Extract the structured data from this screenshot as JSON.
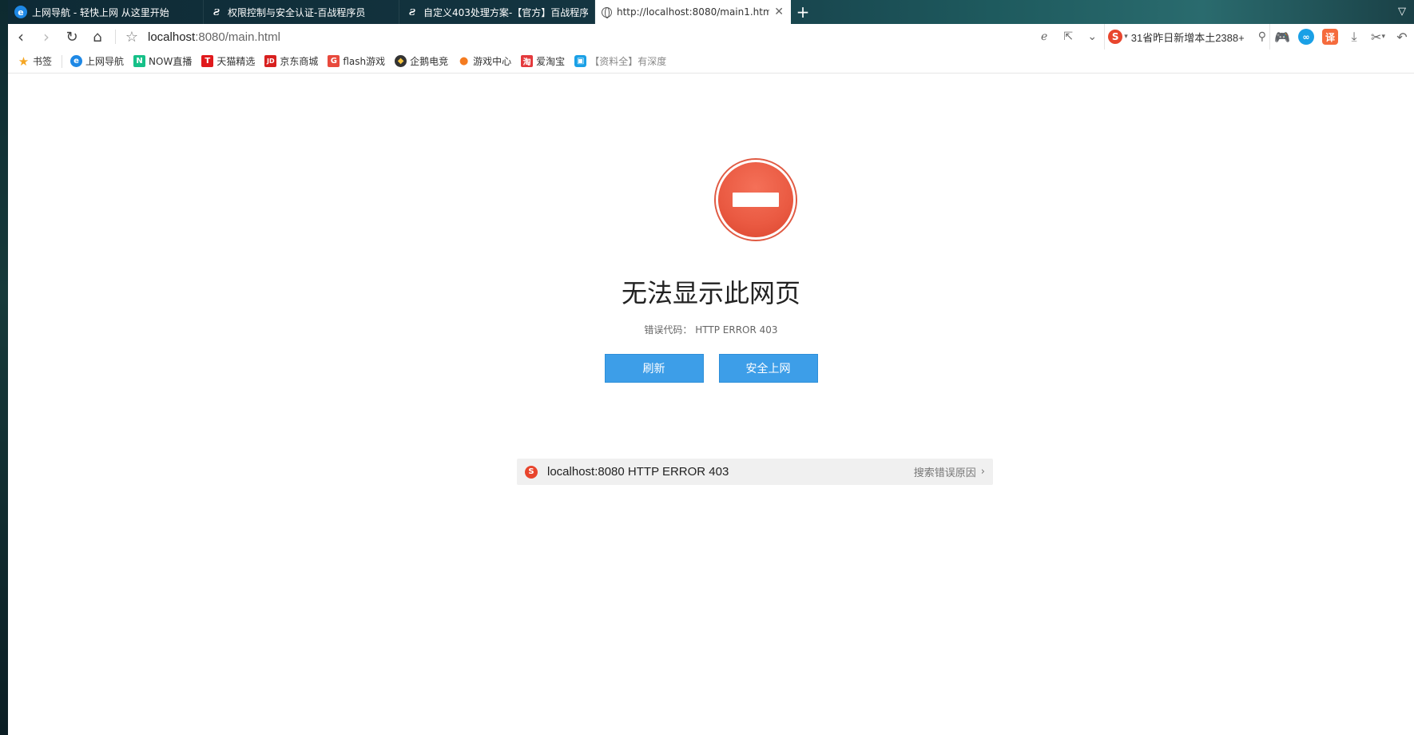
{
  "tabs": [
    {
      "title": "上网导航 - 轻快上网 从这里开始",
      "icon": "ie-icon",
      "active": false
    },
    {
      "title": "权限控制与安全认证-百战程序员",
      "icon": "baizhan-icon",
      "active": false
    },
    {
      "title": "自定义403处理方案-【官方】百战程序员",
      "icon": "baizhan-icon",
      "active": false
    },
    {
      "title": "http://localhost:8080/main1.html",
      "icon": "globe-icon",
      "active": true
    }
  ],
  "address": {
    "host": "localhost",
    "path": ":8080/main.html"
  },
  "search": {
    "value": "31省昨日新增本土2388+"
  },
  "bookmarks": [
    {
      "label": "书签",
      "icon": "star-icon",
      "color": "#f5a623"
    },
    {
      "label": "上网导航",
      "icon": "ie-icon",
      "color": "#1e88e5"
    },
    {
      "label": "NOW直播",
      "icon": "now-icon",
      "color": "#16c088"
    },
    {
      "label": "天猫精选",
      "icon": "tmall-icon",
      "color": "#e0191c"
    },
    {
      "label": "京东商城",
      "icon": "jd-icon",
      "color": "#d8201f"
    },
    {
      "label": "flash游戏",
      "icon": "flash-game-icon",
      "color": "#e84a3d"
    },
    {
      "label": "企鹅电竞",
      "icon": "penguin-esports-icon",
      "color": "#333333"
    },
    {
      "label": "游戏中心",
      "icon": "game-center-icon",
      "color": "#f47b20"
    },
    {
      "label": "爱淘宝",
      "icon": "taobao-icon",
      "color": "#e4393c"
    },
    {
      "label": "【资料全】有深度",
      "icon": "bilibili-icon",
      "color": "#1aa0e6"
    }
  ],
  "error": {
    "title": "无法显示此网页",
    "code_label": "错误代码：",
    "code": "HTTP ERROR 403",
    "refresh_label": "刷新",
    "safe_label": "安全上网"
  },
  "suggest": {
    "text": "localhost:8080 HTTP ERROR 403",
    "link": "搜索错误原因"
  },
  "colors": {
    "accent": "#3d9ee8",
    "error_red": "#ea5a42"
  }
}
